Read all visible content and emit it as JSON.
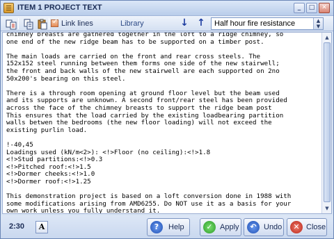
{
  "window": {
    "title": "ITEM 1 PROJECT TEXT"
  },
  "toolbar": {
    "link_lines_label": "Link lines",
    "link_lines_checked": true,
    "library_label": "Library",
    "nav_down": "↓",
    "nav_up": "↑",
    "dropdown_value": "Half hour fire resistance"
  },
  "editor": {
    "lines": [
      "chimney breasts are gathered together in the loft to a ridge chimney, so",
      "one end of the new ridge beam has to be supported on a timber post.",
      "",
      "The main loads are carried on the front and rear cross steels. The",
      "152x152 steel running between them forms one side of the new stairwell;",
      "the front and back walls of the new stairwell are each supported on 2no",
      "50x200's bearing on this steel.",
      "",
      "There is a through room opening at ground floor level but the beam used",
      "and its supports are unknown. A second front/rear steel has been provided",
      "across the face of the chimney breasts to support the ridge beam post",
      "This ensures that the load carried by the existing loadbearing partition",
      "walls betwen the bedrooms (the new floor loading) will not exceed the",
      "existing purlin load.",
      "",
      "!-40,45",
      "Loadings used (kN/m<2>): <!>Floor (no ceiling):<!>1.8",
      "<!>Stud partitions:<!>0.3",
      "<!>Pitched roof:<!>1.5",
      "<!>Dormer cheeks:<!>1.0",
      "<!>Dormer roof:<!>1.25",
      "",
      "This demonstration project is based on a loft conversion done in 1988 with",
      "some modifications arising from AMD6255. Do NOT use it as a basis for your",
      "own work unless you fully understand it."
    ]
  },
  "statusbar": {
    "time": "2:30",
    "font_button": "A"
  },
  "buttons": {
    "help": "Help",
    "apply": "Apply",
    "undo": "Undo",
    "close": "Close"
  }
}
